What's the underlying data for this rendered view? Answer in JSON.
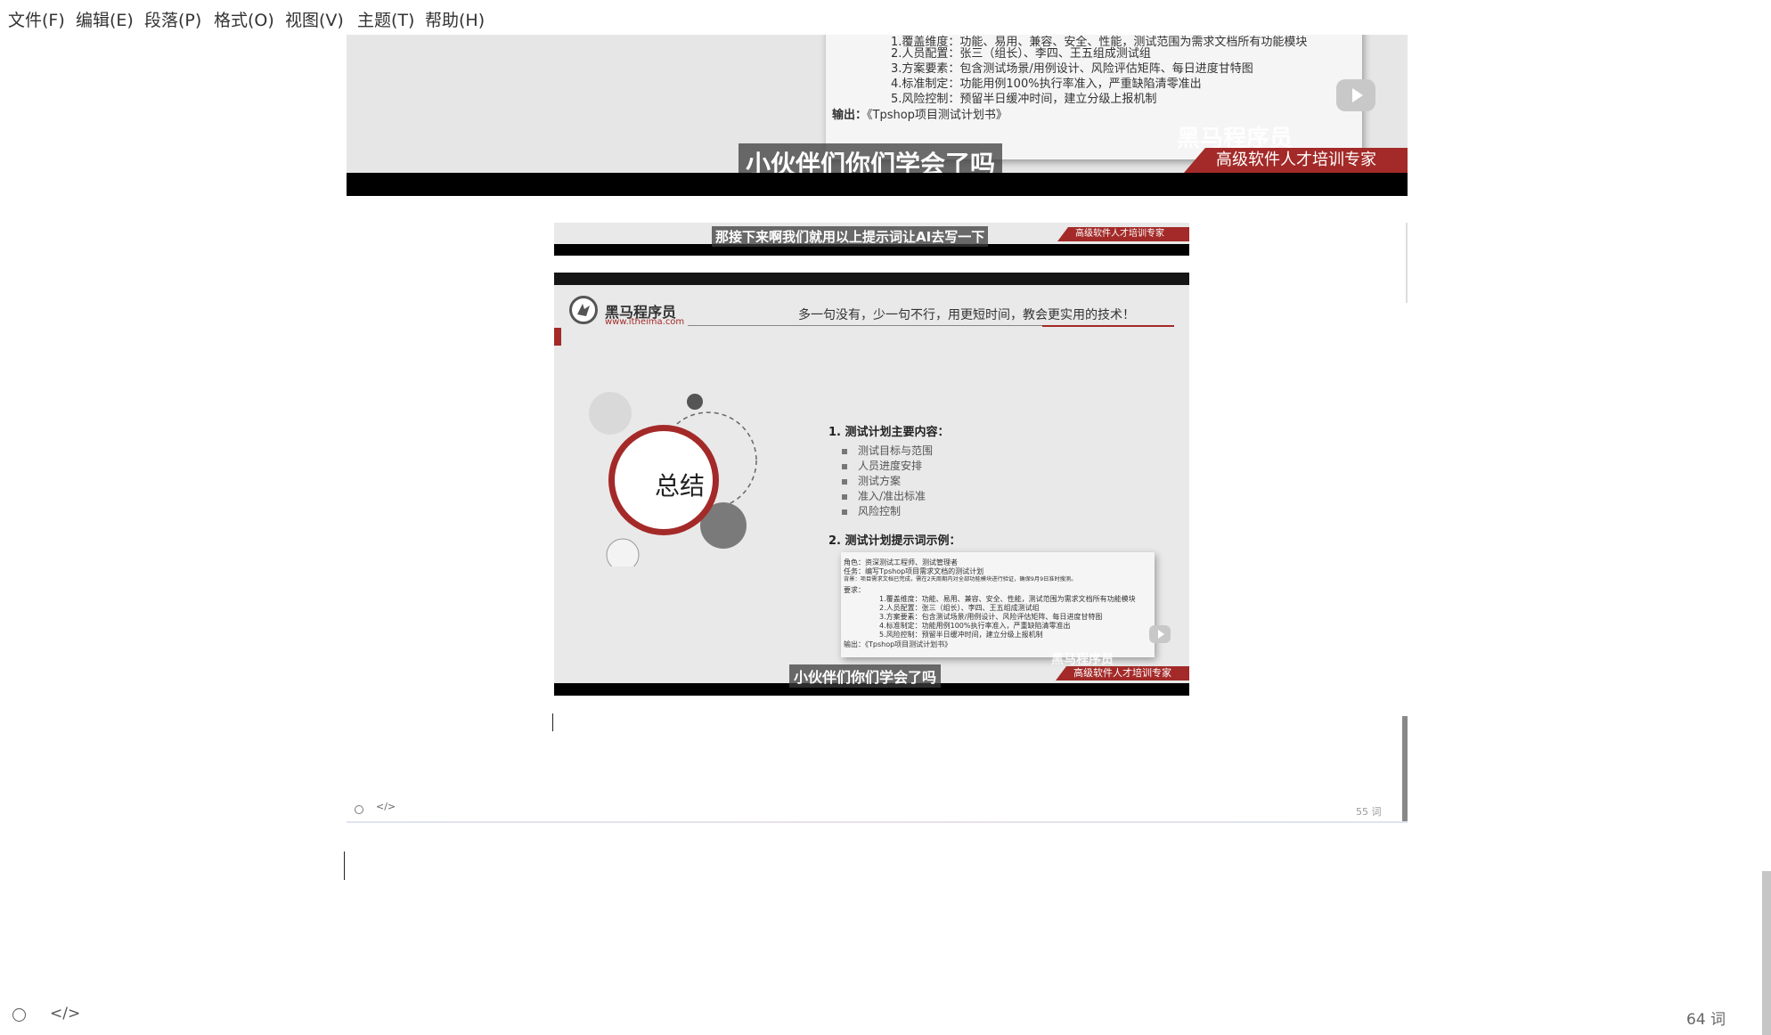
{
  "menu": {
    "file": "文件(F)",
    "edit": "编辑(E)",
    "paragraph": "段落(P)",
    "format": "格式(O)",
    "view": "视图(V)",
    "theme": "主题(T)",
    "help": "帮助(H)"
  },
  "image1": {
    "prompt_lines": [
      "1.覆盖维度：功能、易用、兼容、安全、性能，测试范围为需求文档所有功能模块",
      "2.人员配置：张三（组长）、李四、王五组成测试组",
      "3.方案要素：包含测试场景/用例设计、风险评估矩阵、每日进度甘特图",
      "4.标准制定：功能用例100%执行率准入，严重缺陷清零准出",
      "5.风险控制：预留半日缓冲时间，建立分级上报机制"
    ],
    "output_label": "输出：",
    "output_value": "《Tpshop项目测试计划书》",
    "watermark": "黑马程序员",
    "subtitle": "小伙伴们你们学会了吗",
    "banner": "高级软件人才培训专家"
  },
  "image2": {
    "subtitle": "那接下来啊我们就用以上提示词让AI去写一下",
    "banner": "高级软件人才培训专家"
  },
  "image3": {
    "logo_cn": "黑马程序员",
    "logo_url": "www.itheima.com",
    "slogan": "多一句没有，少一句不行，用更短时间，教会更实用的技术！",
    "circle_label": "总结",
    "section1_title": "1.  测试计划主要内容：",
    "section1_items": [
      "测试目标与范围",
      "人员进度安排",
      "测试方案",
      "准入/准出标准",
      "风险控制"
    ],
    "section2_title": "2.  测试计划提示词示例：",
    "prompt_role": "角色：资深测试工程师、测试管理者",
    "prompt_task": "任务：编写Tpshop项目需求文档的测试计划",
    "prompt_background": "背景：项目需求文档已完成，需在2天周期内对全部功能模块进行验证，确保9月9日准时搜测。",
    "prompt_require": "要求：",
    "prompt_lines": [
      "1.覆盖维度：功能、易用、兼容、安全、性能，测试范围为需求文档所有功能模块",
      "2.人员配置：张三（组长）、李四、王五组成测试组",
      "3.方案要素：包含测试场景/用例设计、风险评估矩阵、每日进度甘特图",
      "4.标准制定：功能用例100%执行率准入，严重缺陷清零准出",
      "5.风险控制：预留半日缓冲时间，建立分级上报机制"
    ],
    "prompt_output": "输出：《Tpshop项目测试计划书》",
    "watermark": "黑马程序员",
    "subtitle": "小伙伴们你们学会了吗",
    "banner": "高级软件人才培训专家"
  },
  "inner_editor": {
    "word_count": "55 词"
  },
  "status": {
    "word_count": "64 词"
  }
}
